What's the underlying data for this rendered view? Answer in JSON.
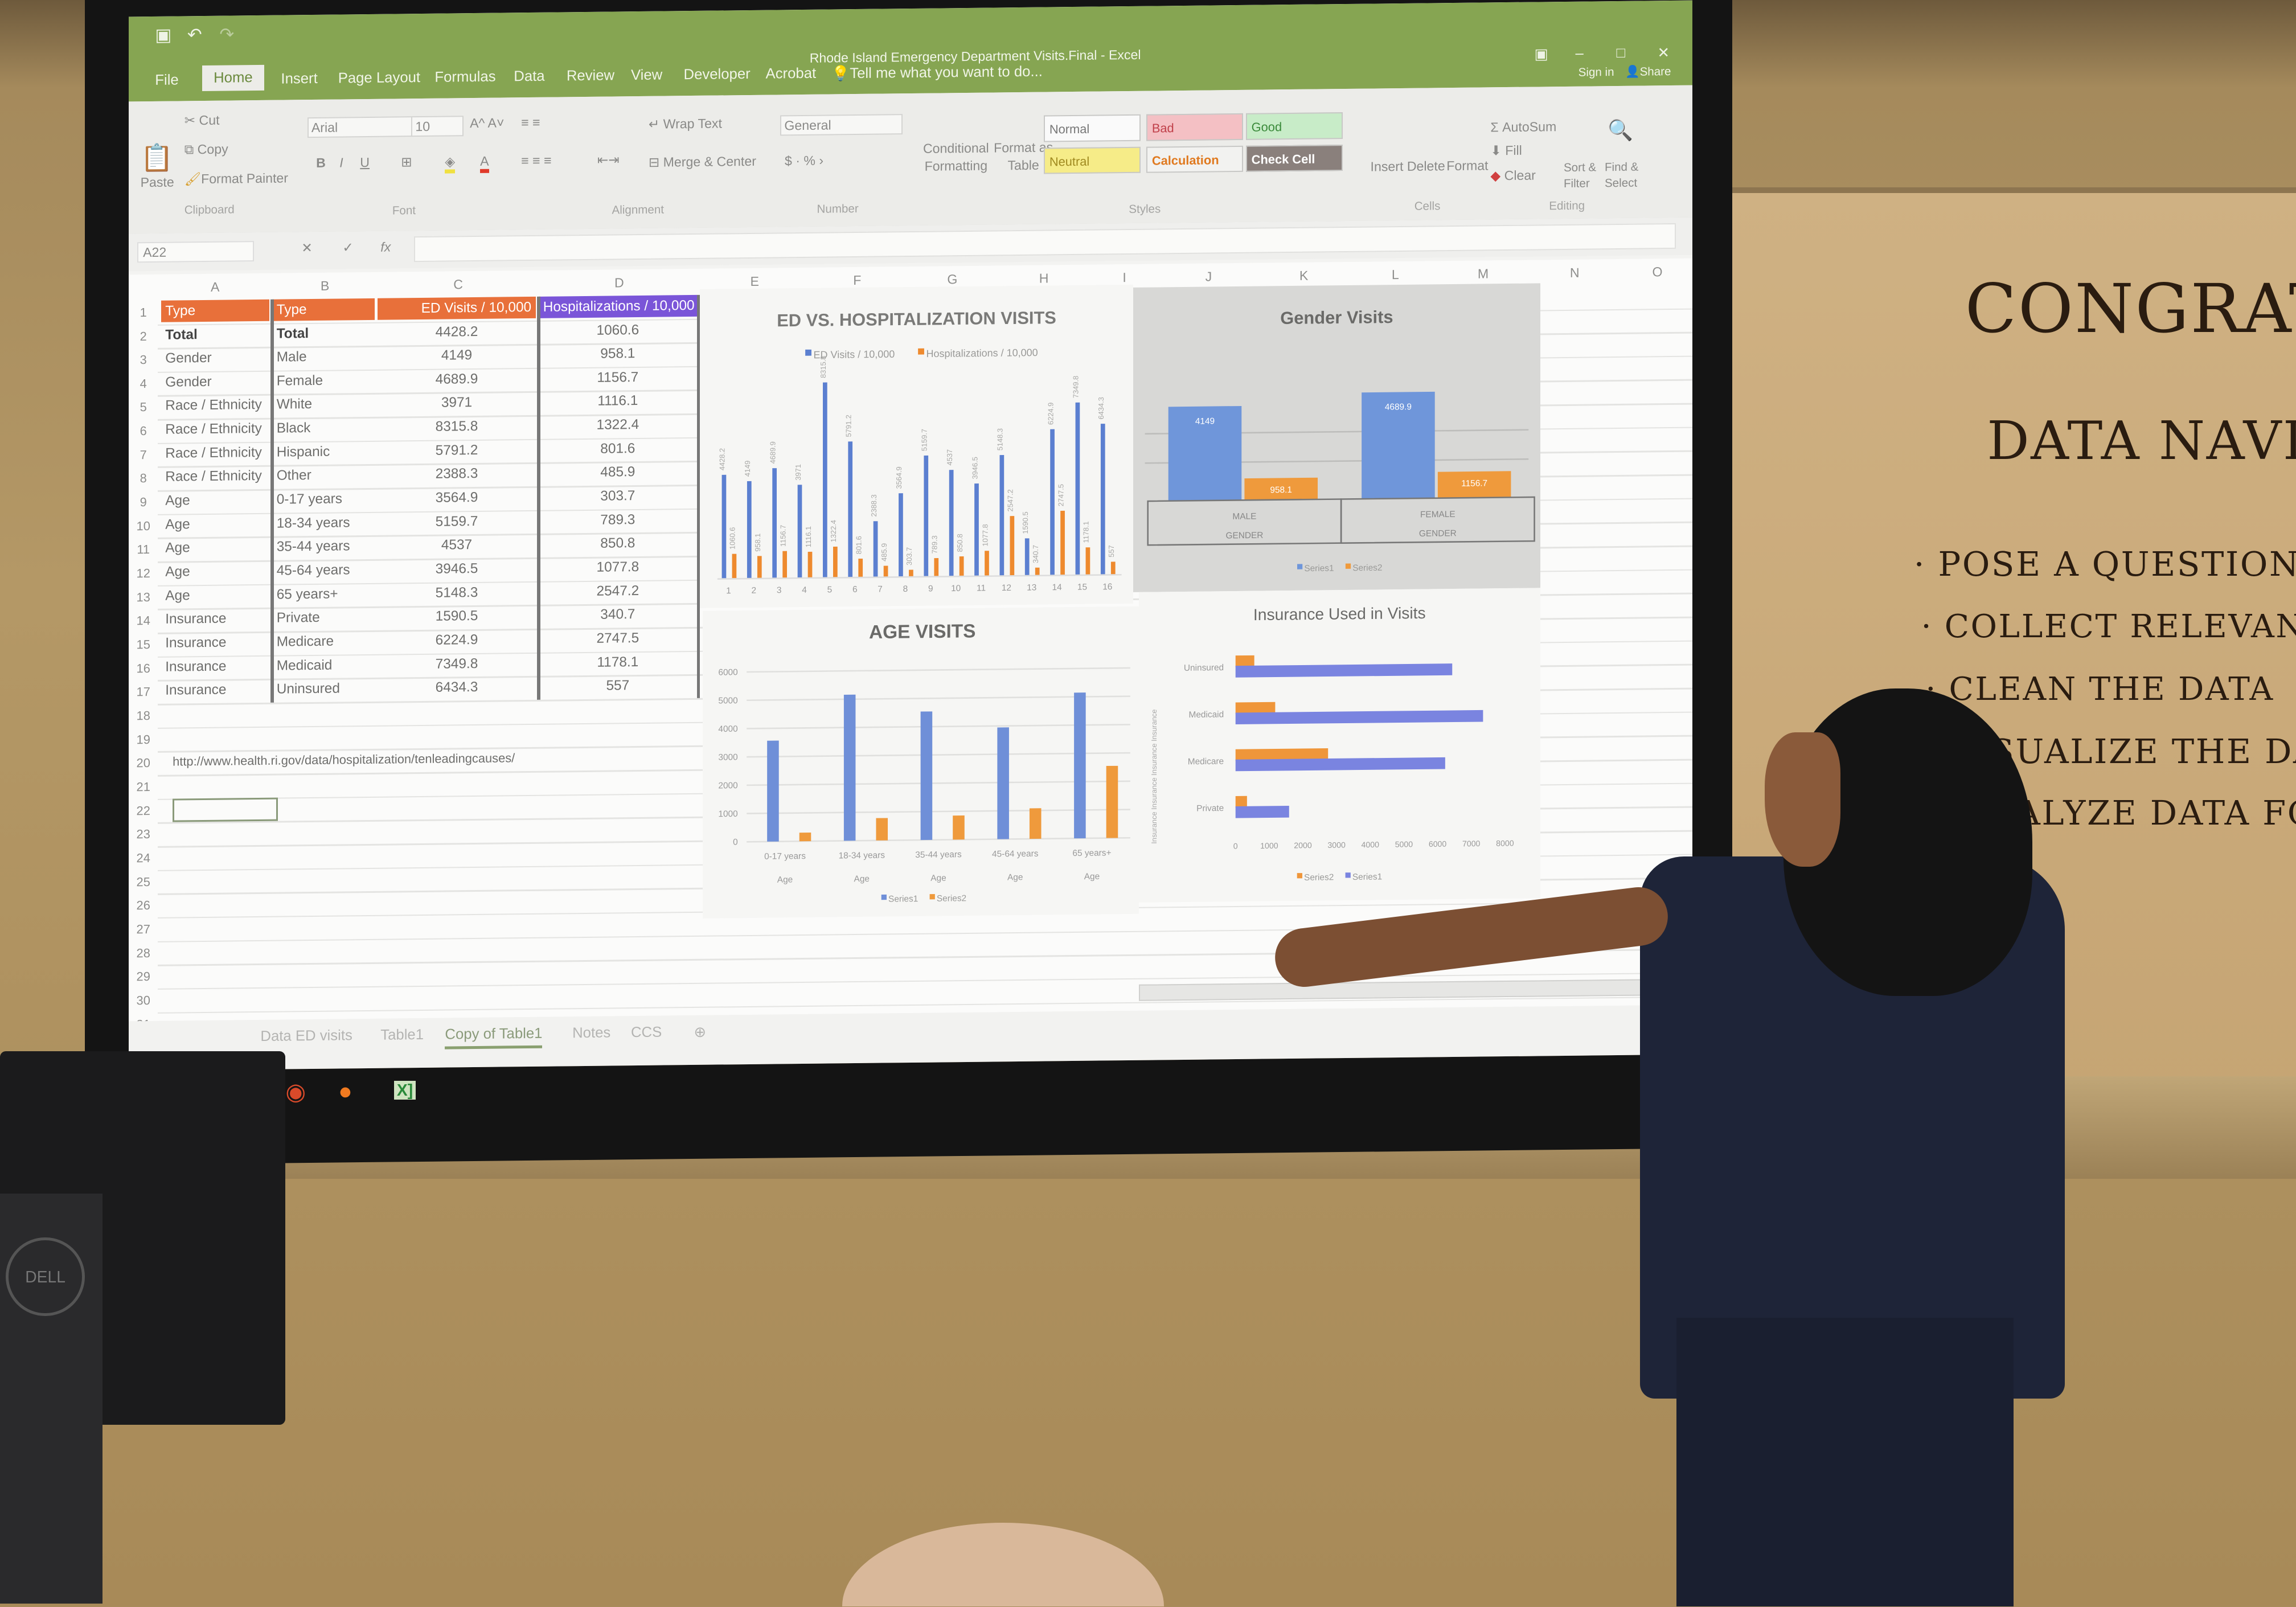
{
  "excel": {
    "window_title": "Rhode Island Emergency Department Visits.Final - Excel",
    "tabs": [
      "File",
      "Home",
      "Insert",
      "Page Layout",
      "Formulas",
      "Data",
      "Review",
      "View",
      "Developer",
      "Acrobat"
    ],
    "tell_me": "Tell me what you want to do...",
    "sign_in": "Sign in",
    "share": "Share",
    "ribbon": {
      "paste": "Paste",
      "cut": "Cut",
      "copy": "Copy",
      "format_painter": "Format Painter",
      "font_name": "Arial",
      "font_size": "10",
      "wrap_text": "Wrap Text",
      "merge_center": "Merge & Center",
      "number_format": "General",
      "conditional_formatting": "Conditional Formatting",
      "format_as_table": "Format as Table",
      "styles": {
        "normal": "Normal",
        "bad": "Bad",
        "good": "Good",
        "neutral": "Neutral",
        "calculation": "Calculation",
        "check_cell": "Check Cell"
      },
      "insert": "Insert",
      "delete": "Delete",
      "format": "Format",
      "autosum": "AutoSum",
      "fill": "Fill",
      "clear": "Clear",
      "sort_filter": "Sort & Filter",
      "find_select": "Find & Select",
      "groups": [
        "Clipboard",
        "Font",
        "Alignment",
        "Number",
        "Styles",
        "Cells",
        "Editing"
      ]
    },
    "name_box": "A22",
    "fx": "fx",
    "columns": [
      "A",
      "B",
      "C",
      "D",
      "E",
      "F",
      "G",
      "H",
      "I",
      "J",
      "K",
      "L",
      "M",
      "N",
      "O"
    ],
    "table": {
      "headers": [
        "Type",
        "Type",
        "ED Visits / 10,000",
        "Hospitalizations / 10,000"
      ],
      "rows": [
        [
          "Total",
          "Total",
          "4428.2",
          "1060.6"
        ],
        [
          "Gender",
          "Male",
          "4149",
          "958.1"
        ],
        [
          "Gender",
          "Female",
          "4689.9",
          "1156.7"
        ],
        [
          "Race / Ethnicity",
          "White",
          "3971",
          "1116.1"
        ],
        [
          "Race / Ethnicity",
          "Black",
          "8315.8",
          "1322.4"
        ],
        [
          "Race / Ethnicity",
          "Hispanic",
          "5791.2",
          "801.6"
        ],
        [
          "Race / Ethnicity",
          "Other",
          "2388.3",
          "485.9"
        ],
        [
          "Age",
          "0-17 years",
          "3564.9",
          "303.7"
        ],
        [
          "Age",
          "18-34 years",
          "5159.7",
          "789.3"
        ],
        [
          "Age",
          "35-44 years",
          "4537",
          "850.8"
        ],
        [
          "Age",
          "45-64 years",
          "3946.5",
          "1077.8"
        ],
        [
          "Age",
          "65 years+",
          "5148.3",
          "2547.2"
        ],
        [
          "Insurance",
          "Private",
          "1590.5",
          "340.7"
        ],
        [
          "Insurance",
          "Medicare",
          "6224.9",
          "2747.5"
        ],
        [
          "Insurance",
          "Medicaid",
          "7349.8",
          "1178.1"
        ],
        [
          "Insurance",
          "Uninsured",
          "6434.3",
          "557"
        ]
      ],
      "header_color": "#e8703a",
      "header_color_d": "#7a55d8"
    },
    "source_url": "http://www.health.ri.gov/data/hospitalization/tenleadingcauses/",
    "sheet_tabs": [
      "Data ED visits",
      "Table1",
      "Copy of Table1",
      "Notes",
      "CCS"
    ],
    "active_sheet": "Copy of Table1"
  },
  "chart_data": [
    {
      "type": "bar",
      "title": "ED VS. HOSPITALIZATION VISITS",
      "categories": [
        "1",
        "2",
        "3",
        "4",
        "5",
        "6",
        "7",
        "8",
        "9",
        "10",
        "11",
        "12",
        "13",
        "14",
        "15",
        "16"
      ],
      "series": [
        {
          "name": "ED Visits / 10,000",
          "color": "#5b7fd0",
          "values": [
            4428.2,
            4149,
            4689.9,
            3971,
            8315.8,
            5791.2,
            2388.3,
            3564.9,
            5159.7,
            4537,
            3946.5,
            5148.3,
            1590.5,
            6224.9,
            7349.8,
            6434.3
          ]
        },
        {
          "name": "Hospitalizations / 10,000",
          "color": "#ee8a2e",
          "values": [
            1060.6,
            958.1,
            1156.7,
            1116.1,
            1322.4,
            801.6,
            485.9,
            303.7,
            789.3,
            850.8,
            1077.8,
            2547.2,
            340.7,
            2747.5,
            1178.1,
            557
          ]
        }
      ],
      "legend": "top",
      "data_labels": true
    },
    {
      "type": "bar",
      "title": "Gender Visits",
      "categories": [
        "MALE",
        "FEMALE"
      ],
      "group_label": "GENDER",
      "series": [
        {
          "name": "Series1",
          "color": "#6f96da",
          "values": [
            4149,
            4689.9
          ]
        },
        {
          "name": "Series2",
          "color": "#ef9a3c",
          "values": [
            958.1,
            1156.7
          ]
        }
      ],
      "legend": "bottom",
      "data_labels": true
    },
    {
      "type": "bar",
      "title": "AGE VISITS",
      "categories": [
        "0-17 years",
        "18-34 years",
        "35-44 years",
        "45-64 years",
        "65 years+"
      ],
      "group_label": "Age",
      "ylim": [
        0,
        6000
      ],
      "yticks": [
        "0",
        "1000",
        "2000",
        "3000",
        "4000",
        "5000",
        "6000"
      ],
      "series": [
        {
          "name": "Series1",
          "color": "#6f8fd8",
          "values": [
            3564.9,
            5159.7,
            4537,
            3946.5,
            5148.3
          ]
        },
        {
          "name": "Series2",
          "color": "#ef9a3c",
          "values": [
            303.7,
            789.3,
            850.8,
            1077.8,
            2547.2
          ]
        }
      ],
      "legend": "bottom",
      "grid": true
    },
    {
      "type": "bar",
      "orientation": "horizontal",
      "title": "Insurance Used in Visits",
      "categories": [
        "Private",
        "Medicare",
        "Medicaid",
        "Uninsured"
      ],
      "group_label": "Insurance",
      "xlim": [
        0,
        8000
      ],
      "xticks": [
        "0",
        "1000",
        "2000",
        "3000",
        "4000",
        "5000",
        "6000",
        "7000",
        "8000"
      ],
      "series": [
        {
          "name": "Series1",
          "color": "#7a84e0",
          "values": [
            1590.5,
            6224.9,
            7349.8,
            6434.3
          ]
        },
        {
          "name": "Series2",
          "color": "#ef963a",
          "values": [
            340.7,
            2747.5,
            1178.1,
            557
          ]
        }
      ],
      "legend_order": [
        "Series2",
        "Series1"
      ],
      "legend": "bottom"
    }
  ],
  "whiteboard": {
    "title_line1": "CONGRATUL",
    "title_line2": "DATA NAVIG",
    "bullets": [
      "POSE A QUESTION",
      "COLLECT RELEVANT D",
      "CLEAN THE DATA",
      "VISUALIZE THE DATA",
      "ANALYZE DATA FOR"
    ]
  },
  "monitor_brand": "DELL"
}
